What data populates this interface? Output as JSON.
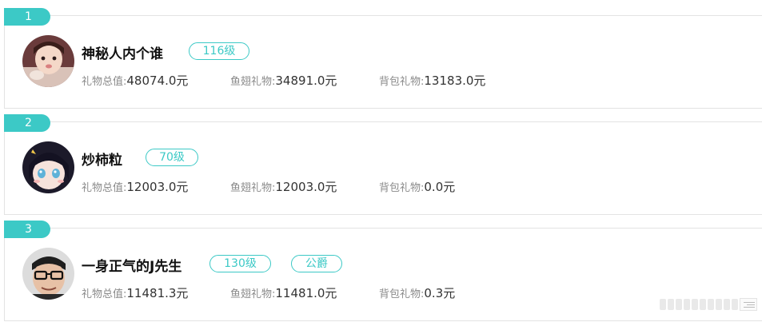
{
  "entries": [
    {
      "rank": "1",
      "name": "神秘人内个谁",
      "level": "116级",
      "noble": "",
      "stats": [
        {
          "label": "礼物总值:",
          "value": "48074.0元"
        },
        {
          "label": "鱼翅礼物:",
          "value": "34891.0元"
        },
        {
          "label": "背包礼物:",
          "value": "13183.0元"
        }
      ],
      "avatar_icon": "child-photo-avatar"
    },
    {
      "rank": "2",
      "name": "炒柿粒",
      "level": "70级",
      "noble": "",
      "stats": [
        {
          "label": "礼物总值:",
          "value": "12003.0元"
        },
        {
          "label": "鱼翅礼物:",
          "value": "12003.0元"
        },
        {
          "label": "背包礼物:",
          "value": "0.0元"
        }
      ],
      "avatar_icon": "anime-girl-avatar"
    },
    {
      "rank": "3",
      "name": "一身正气的J先生",
      "level": "130级",
      "noble": "公爵",
      "stats": [
        {
          "label": "礼物总值:",
          "value": "11481.3元"
        },
        {
          "label": "鱼翅礼物:",
          "value": "11481.0元"
        },
        {
          "label": "背包礼物:",
          "value": "0.3元"
        }
      ],
      "avatar_icon": "man-with-glasses-avatar"
    }
  ],
  "colors": {
    "accent": "#3cc9c6",
    "label": "#8a8a8a",
    "border": "#e3e3e3"
  }
}
